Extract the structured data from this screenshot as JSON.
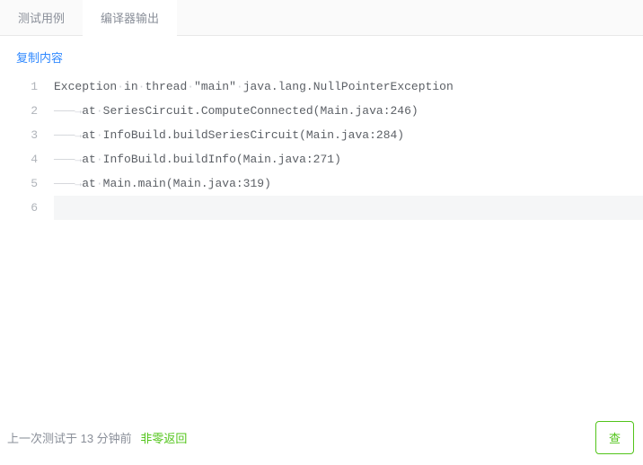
{
  "tabs": {
    "test_cases": "测试用例",
    "compiler_output": "编译器输出"
  },
  "copy_label": "复制内容",
  "code": {
    "lines": [
      {
        "n": "1",
        "indent": "",
        "text": "Exception in thread \"main\" java.lang.NullPointerException"
      },
      {
        "n": "2",
        "indent": "tab",
        "text": "at SeriesCircuit.ComputeConnected(Main.java:246)"
      },
      {
        "n": "3",
        "indent": "tab",
        "text": "at InfoBuild.buildSeriesCircuit(Main.java:284)"
      },
      {
        "n": "4",
        "indent": "tab",
        "text": "at InfoBuild.buildInfo(Main.java:271)"
      },
      {
        "n": "5",
        "indent": "tab",
        "text": "at Main.main(Main.java:319)"
      },
      {
        "n": "6",
        "indent": "",
        "text": ""
      }
    ]
  },
  "footer": {
    "prefix": "上一次测试于 13 分钟前",
    "status": "非零返回",
    "button": "查"
  }
}
